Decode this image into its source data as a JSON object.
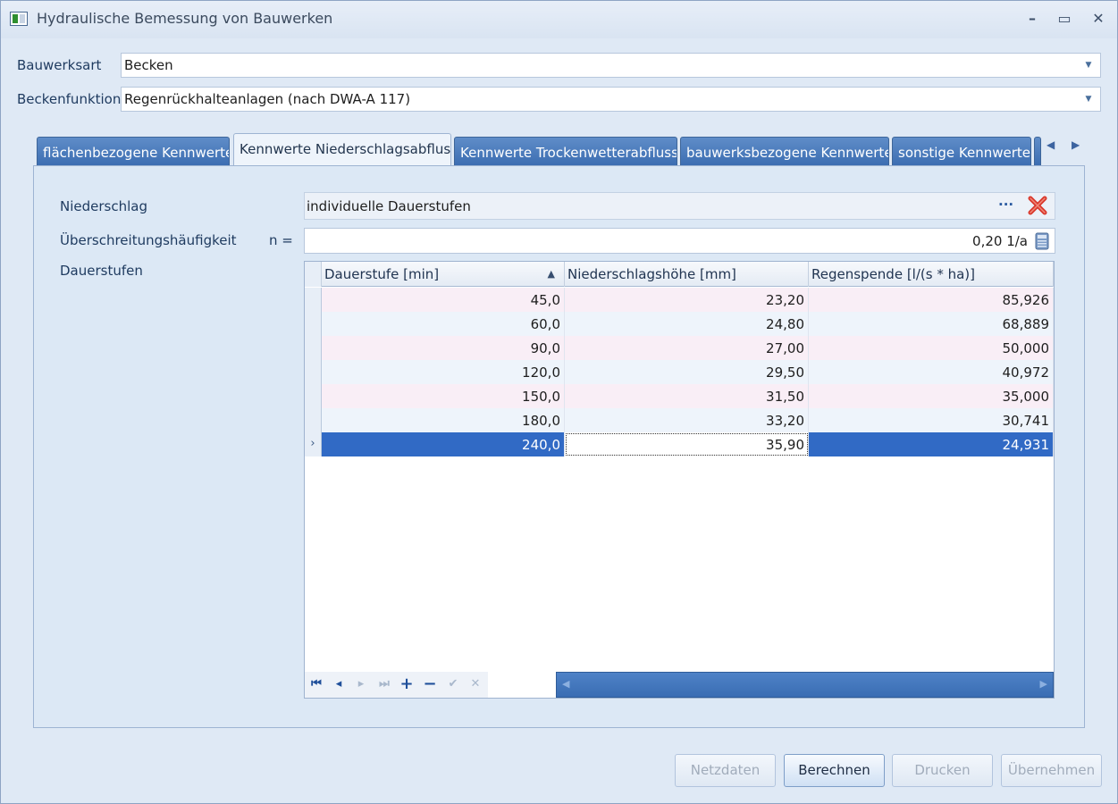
{
  "window": {
    "title": "Hydraulische Bemessung von Bauwerken",
    "controls": {
      "minimize": "–",
      "maximize": "▭",
      "close": "✕"
    }
  },
  "form": {
    "bauwerksart_label": "Bauwerksart",
    "bauwerksart_value": "Becken",
    "beckenfunktion_label": "Beckenfunktion",
    "beckenfunktion_value": "Regenrückhalteanlagen (nach DWA-A 117)"
  },
  "tabs": [
    {
      "label": "flächenbezogene Kennwerte",
      "active": false
    },
    {
      "label": "Kennwerte Niederschlagsabfluss",
      "active": true
    },
    {
      "label": "Kennwerte Trockenwetterabfluss",
      "active": false
    },
    {
      "label": "bauwerksbezogene Kennwerte",
      "active": false
    },
    {
      "label": "sonstige Kennwerte",
      "active": false
    }
  ],
  "tab_nav": {
    "prev": "◀",
    "next": "▶"
  },
  "panel": {
    "niederschlag_label": "Niederschlag",
    "niederschlag_value": "individuelle Dauerstufen",
    "ellipsis": "···",
    "ueberschreitung_label": "Überschreitungshäufigkeit",
    "n_label": "n =",
    "ueberschreitung_value": "0,20 1/a",
    "dauerstufen_label": "Dauerstufen"
  },
  "grid": {
    "columns": [
      "Dauerstufe [min]",
      "Niederschlagshöhe [mm]",
      "Regenspende  [l/(s * ha)]"
    ],
    "sort_indicator": "▲",
    "current_row_marker": "›",
    "rows": [
      [
        "45,0",
        "23,20",
        "85,926"
      ],
      [
        "60,0",
        "24,80",
        "68,889"
      ],
      [
        "90,0",
        "27,00",
        "50,000"
      ],
      [
        "120,0",
        "29,50",
        "40,972"
      ],
      [
        "150,0",
        "31,50",
        "35,000"
      ],
      [
        "180,0",
        "33,20",
        "30,741"
      ],
      [
        "240,0",
        "35,90",
        "24,931"
      ]
    ],
    "selected_row": 6,
    "navigator": {
      "first": "⏮",
      "prev": "◂",
      "next": "▸",
      "last": "⏭",
      "add": "+",
      "remove": "−",
      "apply": "✔",
      "cancel": "✕"
    }
  },
  "buttons": {
    "netzdaten": "Netzdaten",
    "berechnen": "Berechnen",
    "drucken": "Drucken",
    "uebernehmen": "Übernehmen"
  },
  "colors": {
    "tab_blue": "#3b6db1",
    "selection": "#316ac5",
    "delete_red": "#d9372b"
  }
}
